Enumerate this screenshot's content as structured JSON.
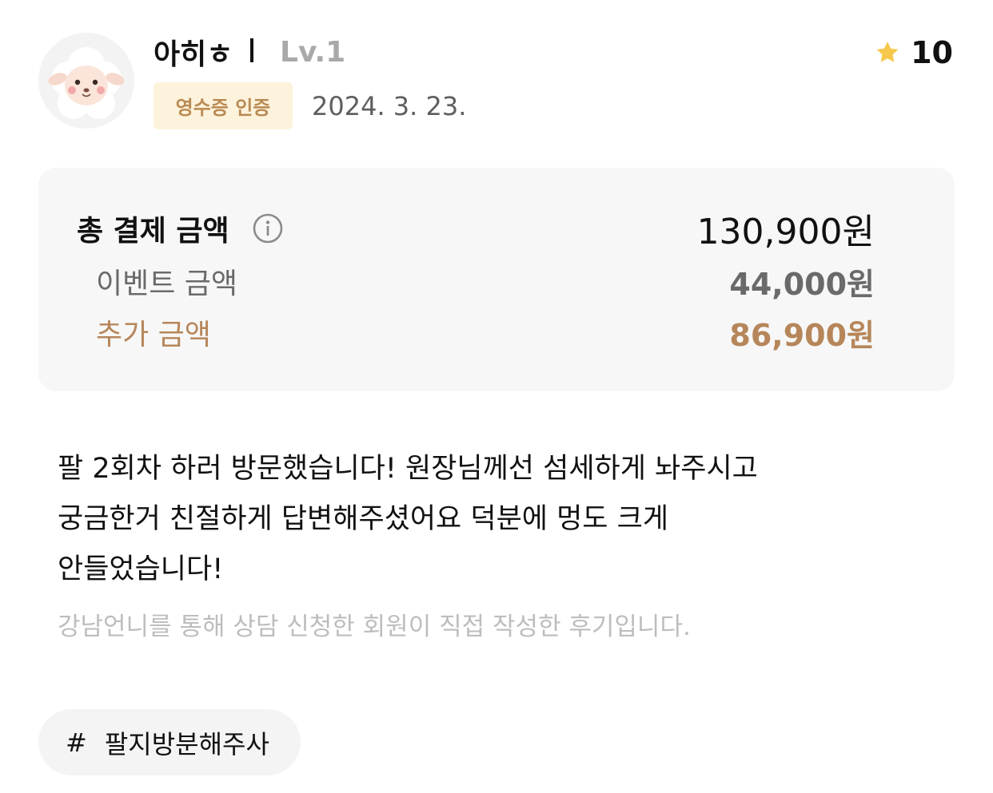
{
  "reviewer": {
    "nickname": "아히ㅎ",
    "level": "Lv.1",
    "avatar_icon": "sheep-avatar-icon"
  },
  "badge": {
    "label": "영수증 인증"
  },
  "date": "2024. 3. 23.",
  "rating": {
    "icon": "star-icon",
    "value": "10",
    "star_color": "#f6c84c"
  },
  "payment": {
    "total_label": "총 결제 금액",
    "total_amount": "130,900원",
    "info_icon": "info-icon",
    "event_label": "이벤트 금액",
    "event_amount": "44,000원",
    "extra_label": "추가 금액",
    "extra_amount": "86,900원"
  },
  "review_lines": [
    "팔 2회차 하러 방문했습니다! 원장님께선 섬세하게 놔주시고",
    "궁금한거 친절하게 답변해주셨어요 덕분에 멍도 크게",
    "안들었습니다!"
  ],
  "notice": "강남언니를 통해 상담 신청한 회원이 직접 작성한 후기입니다.",
  "tag": {
    "hash": "#",
    "label": "팔지방분해주사"
  },
  "colors": {
    "accent_brown": "#b6865a",
    "badge_bg": "#fdf3dc",
    "card_bg": "#f7f7f7",
    "muted_gray": "#6a6a6a"
  }
}
